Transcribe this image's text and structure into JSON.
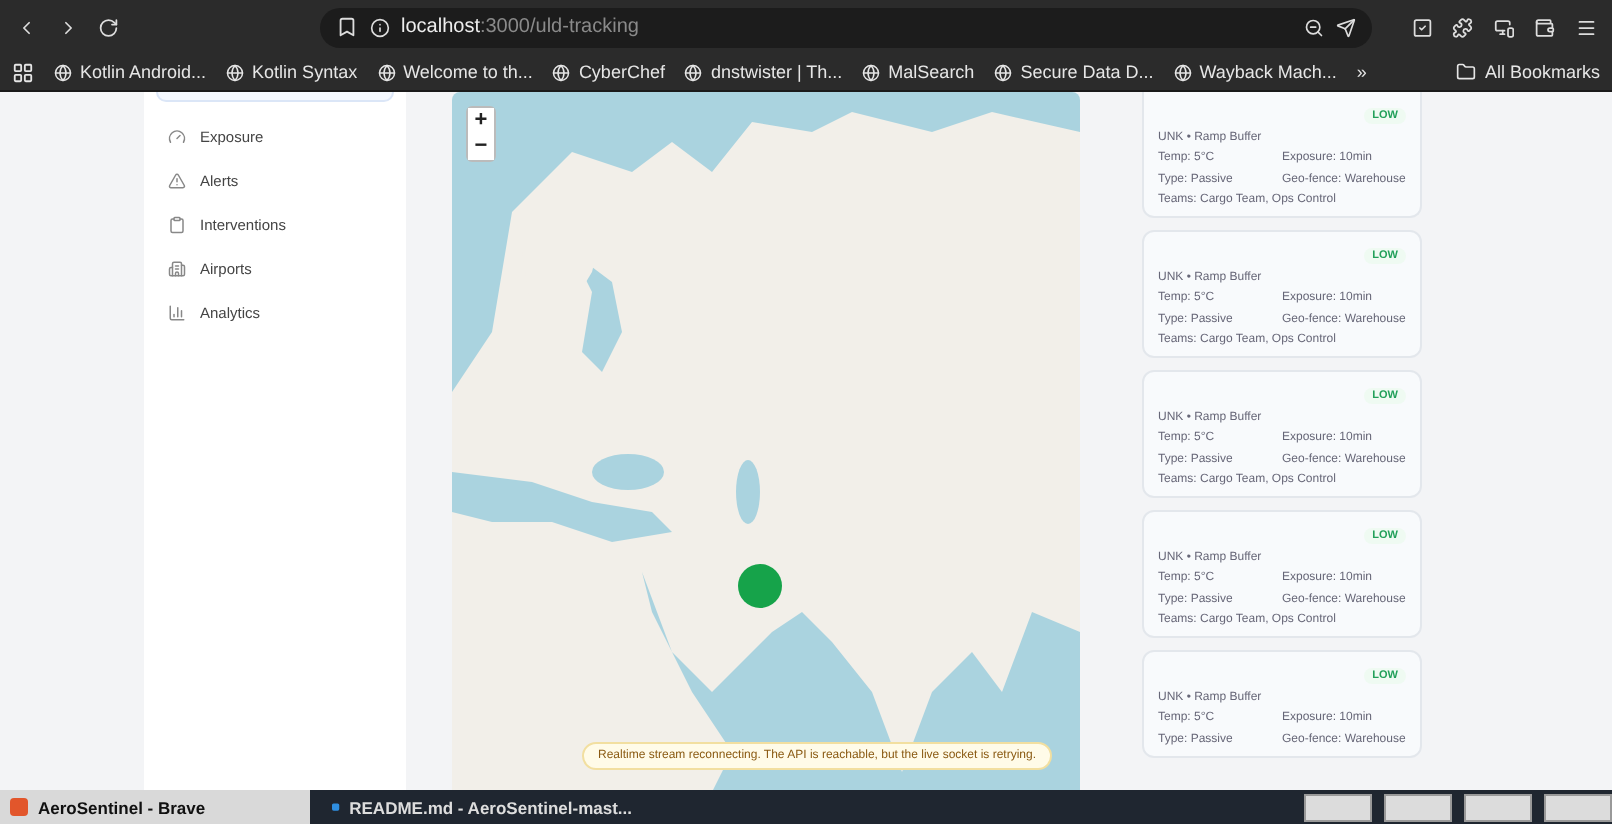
{
  "browser": {
    "url_host": "localhost",
    "url_path": ":3000/uld-tracking",
    "bookmarks": [
      {
        "label": "Kotlin Android..."
      },
      {
        "label": "Kotlin Syntax"
      },
      {
        "label": "Welcome to th..."
      },
      {
        "label": "CyberChef"
      },
      {
        "label": "dnstwister | Th..."
      },
      {
        "label": "MalSearch"
      },
      {
        "label": "Secure Data D..."
      },
      {
        "label": "Wayback Mach..."
      }
    ],
    "more": "»",
    "all_bookmarks": "All Bookmarks"
  },
  "sidebar": {
    "items": [
      {
        "label": "Exposure"
      },
      {
        "label": "Alerts"
      },
      {
        "label": "Interventions"
      },
      {
        "label": "Airports"
      },
      {
        "label": "Analytics"
      }
    ]
  },
  "map": {
    "zoom_in": "+",
    "zoom_out": "−",
    "toast": "Realtime stream reconnecting. The API is reachable, but the live socket is retrying."
  },
  "cards": [
    {
      "risk": "LOW",
      "title": "UNK • Ramp Buffer",
      "temp": "Temp: 5°C",
      "exposure": "Exposure: 10min",
      "type": "Type: Passive",
      "geofence": "Geo-fence: Warehouse",
      "teams": "Teams: Cargo Team, Ops Control"
    },
    {
      "risk": "LOW",
      "title": "UNK • Ramp Buffer",
      "temp": "Temp: 5°C",
      "exposure": "Exposure: 10min",
      "type": "Type: Passive",
      "geofence": "Geo-fence: Warehouse",
      "teams": "Teams: Cargo Team, Ops Control"
    },
    {
      "risk": "LOW",
      "title": "UNK • Ramp Buffer",
      "temp": "Temp: 5°C",
      "exposure": "Exposure: 10min",
      "type": "Type: Passive",
      "geofence": "Geo-fence: Warehouse",
      "teams": "Teams: Cargo Team, Ops Control"
    },
    {
      "risk": "LOW",
      "title": "UNK • Ramp Buffer",
      "temp": "Temp: 5°C",
      "exposure": "Exposure: 10min",
      "type": "Type: Passive",
      "geofence": "Geo-fence: Warehouse",
      "teams": "Teams: Cargo Team, Ops Control"
    },
    {
      "risk": "LOW",
      "title": "UNK • Ramp Buffer",
      "temp": "Temp: 5°C",
      "exposure": "Exposure: 10min",
      "type": "Type: Passive",
      "geofence": "Geo-fence: Warehouse"
    }
  ],
  "taskbar": {
    "items": [
      {
        "label": "AeroSentinel - Brave",
        "selected": true
      },
      {
        "label": "README.md - AeroSentinel-mast...",
        "selected": false
      }
    ]
  }
}
